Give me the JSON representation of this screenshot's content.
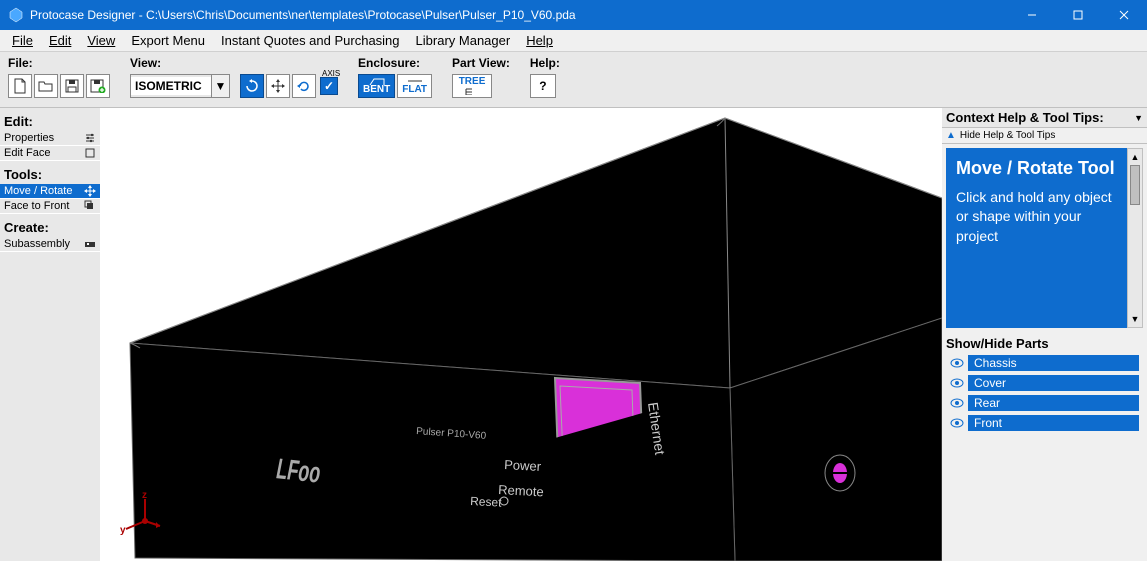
{
  "window": {
    "title": "Protocase Designer - C:\\Users\\Chris\\Documents\\ner\\templates\\Protocase\\Pulser\\Pulser_P10_V60.pda"
  },
  "menubar": {
    "file": "File",
    "edit": "Edit",
    "view": "View",
    "export": "Export Menu",
    "quotes": "Instant Quotes and Purchasing",
    "library": "Library Manager",
    "help": "Help"
  },
  "toolbar": {
    "file_label": "File:",
    "view_label": "View:",
    "view_value": "ISOMETRIC",
    "axis_label": "AXIS",
    "enclosure_label": "Enclosure:",
    "bent_label": "BENT",
    "flat_label": "FLAT",
    "partview_label": "Part View:",
    "tree_label": "TREE",
    "help_label": "Help:",
    "help_q": "?"
  },
  "leftbar": {
    "edit_title": "Edit:",
    "properties": "Properties",
    "edit_face": "Edit Face",
    "tools_title": "Tools:",
    "move_rotate": "Move / Rotate",
    "face_to_front": "Face to Front",
    "create_title": "Create:",
    "subassembly": "Subassembly"
  },
  "viewport": {
    "labels": {
      "ethernet": "Ethernet",
      "power": "Power",
      "reset": "Reset",
      "remote": "Remote",
      "model": "Pulser P10-V60",
      "z": "z",
      "y": "y",
      "x": "x"
    }
  },
  "rightbar": {
    "title": "Context Help & Tool Tips:",
    "collapse": "Hide Help & Tool Tips",
    "help_title": "Move / Rotate Tool",
    "help_body": "Click and hold any object or shape within your project",
    "parts_title": "Show/Hide Parts",
    "parts": [
      "Chassis",
      "Cover",
      "Rear",
      "Front"
    ]
  }
}
